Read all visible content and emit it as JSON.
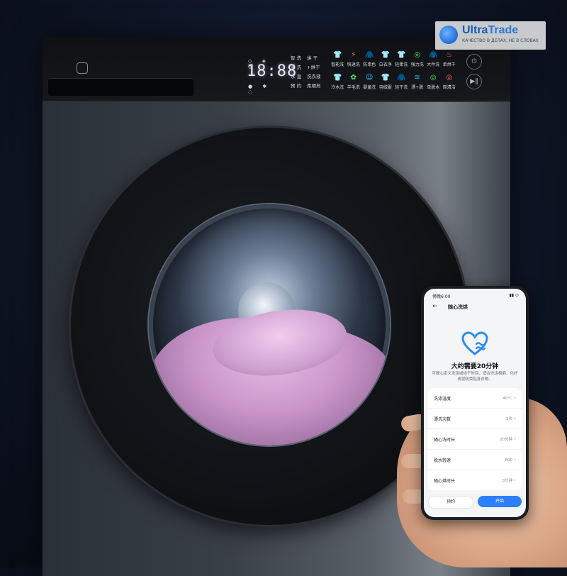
{
  "panel": {
    "display_digits": "18:88",
    "options_col1": [
      "智 洗",
      "漂 洗",
      "水 温",
      "预 约"
    ],
    "options_col2": [
      "烘 干",
      "+烘干",
      "洗衣液",
      "柔顺剂"
    ],
    "programs_row1": [
      {
        "icon": "shirt-icon",
        "label": "智能洗",
        "color": "#4fb7ff"
      },
      {
        "icon": "lightning-icon",
        "label": "快速洗",
        "color": "#ff7b7b"
      },
      {
        "icon": "sweater-icon",
        "label": "防串色",
        "color": "#ff9a3c"
      },
      {
        "icon": "shirt-icon",
        "label": "白衣净",
        "color": "#4fb7ff"
      },
      {
        "icon": "shirt-icon",
        "label": "轻柔洗",
        "color": "#ff6fa5"
      },
      {
        "icon": "drum-icon",
        "label": "强力洗",
        "color": "#6fe08a"
      },
      {
        "icon": "sweater-icon",
        "label": "大件洗",
        "color": "#ff9a3c"
      },
      {
        "icon": "dry-icon",
        "label": "单烘干",
        "color": "#ff7b7b"
      }
    ],
    "programs_row2": [
      {
        "icon": "shirt-icon",
        "label": "冷水洗",
        "color": "#4fb7ff"
      },
      {
        "icon": "wool-icon",
        "label": "羊毛洗",
        "color": "#6fe08a"
      },
      {
        "icon": "baby-icon",
        "label": "婴童洗",
        "color": "#4fb7ff"
      },
      {
        "icon": "shirt-icon",
        "label": "羽绒服",
        "color": "#ffcf4f"
      },
      {
        "icon": "sweater-icon",
        "label": "轻干洗",
        "color": "#ff9a3c"
      },
      {
        "icon": "rinse-icon",
        "label": "漂+脱",
        "color": "#4fb7ff"
      },
      {
        "icon": "drum-icon",
        "label": "单脱水",
        "color": "#6fe08a"
      },
      {
        "icon": "drum-icon",
        "label": "筒清洁",
        "color": "#ff7b7b"
      }
    ]
  },
  "watermark": {
    "title_a": "Ultra",
    "title_b": "Trade",
    "subtitle": "КАЧЕСТВО В ДЕЛАХ, НЕ В СЛОВАХ"
  },
  "phone": {
    "status_time": "傍晚6:00",
    "status_right": "▮▮ ⊙",
    "back": "←",
    "title": "随心洗烘",
    "headline": "大约需要20分钟",
    "description": "可随心定义洗涤或烘干时间，适合洗涤棉麻、化纤或混纺类贴身衣物。",
    "settings": [
      {
        "label": "洗涤温度",
        "value": "40°C"
      },
      {
        "label": "漂洗次数",
        "value": "1次"
      },
      {
        "label": "随心洗时长",
        "value": "20分钟"
      },
      {
        "label": "脱水转速",
        "value": "800"
      },
      {
        "label": "随心烘时长",
        "value": "0分钟"
      }
    ],
    "btn_schedule": "预约",
    "btn_start": "开始"
  },
  "colors": {
    "accent": "#2d7ff9",
    "heart": "#2d8cf0"
  }
}
